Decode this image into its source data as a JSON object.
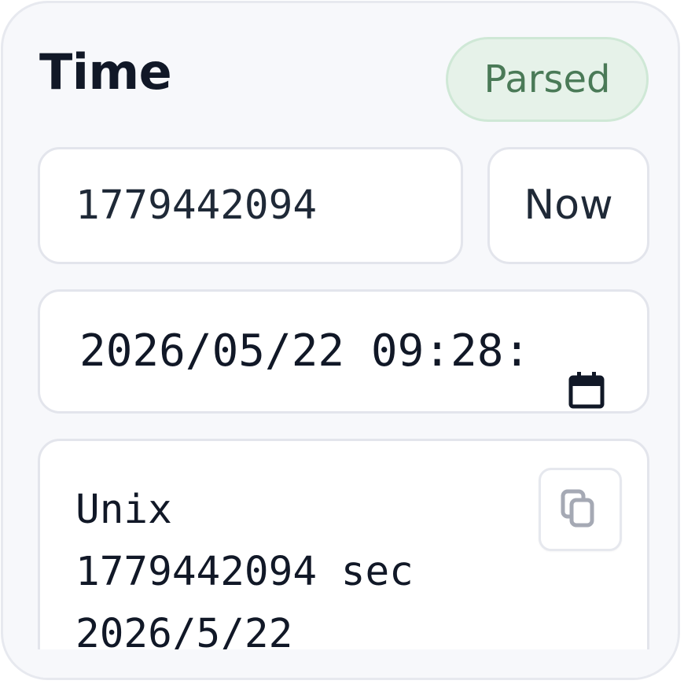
{
  "header": {
    "title": "Time",
    "status_badge": "Parsed",
    "status_color": "#4a7a57"
  },
  "timestamp_input": {
    "value": "1779442094"
  },
  "now_button": {
    "label": "Now"
  },
  "datetime_input": {
    "value": "2026/05/22 09:28:",
    "icon": "calendar-icon"
  },
  "result": {
    "lines": [
      "Unix",
      "1779442094 sec",
      "2026/5/22"
    ],
    "copy_icon": "copy-icon"
  }
}
